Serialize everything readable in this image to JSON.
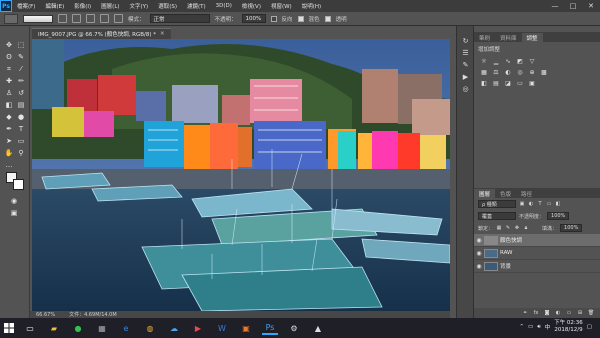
{
  "app": {
    "logo_text": "Ps",
    "menu": [
      "檔案(F)",
      "編輯(E)",
      "影像(I)",
      "圖層(L)",
      "文字(Y)",
      "選取(S)",
      "濾鏡(T)",
      "3D(D)",
      "檢視(V)",
      "視窗(W)",
      "說明(H)"
    ],
    "window_controls": [
      "—",
      "□",
      "✕"
    ]
  },
  "options_bar": {
    "mode_label": "模式：",
    "mode_value": "正常",
    "opacity_label": "不透明：",
    "opacity_value": "100%",
    "chk1_label": "反向",
    "chk2_label": "混色",
    "chk3_label": "透明"
  },
  "document": {
    "tab_title": "IMG_9007.JPG @ 66.7% (顏色快調, RGB/8) *",
    "close": "✕"
  },
  "status": {
    "zoom": "66.67%",
    "doc_size": "文件：4.69M/14.0M"
  },
  "adjustments_panel": {
    "tabs": [
      "筆刷",
      "資料庫",
      "調整"
    ],
    "active_tab": 2,
    "title": "增加調整"
  },
  "layers_panel": {
    "tabs": [
      "圖層",
      "色版",
      "路徑"
    ],
    "active_tab": 0,
    "filter_label": "ρ 種類",
    "blend_mode": "覆蓋",
    "opacity_label": "不透明度：",
    "opacity_value": "100%",
    "lock_label": "鎖定：",
    "fill_label": "填滿：",
    "fill_value": "100%",
    "layers": [
      {
        "name": "顏色快調",
        "selected": true
      },
      {
        "name": "RAW",
        "selected": false
      },
      {
        "name": "背景",
        "selected": false
      }
    ]
  },
  "taskbar": {
    "language": "中",
    "time": "下午 02:36",
    "date": "2018/12/9",
    "ps_label": "Ps"
  },
  "colors": {
    "accent": "#31a8ff",
    "panel_bg": "#535353",
    "taskbar_bg": "#1f1f28"
  }
}
